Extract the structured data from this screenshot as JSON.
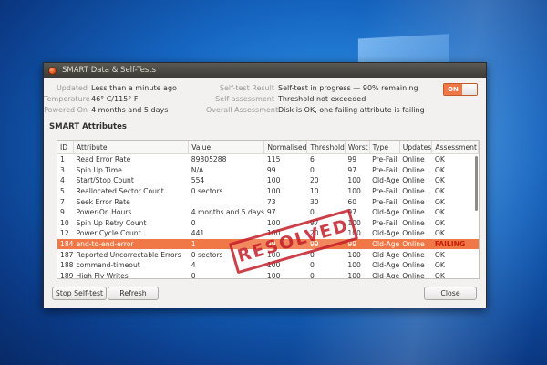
{
  "window": {
    "title": "SMART Data & Self-Tests"
  },
  "info": {
    "updated": {
      "label": "Updated",
      "value": "Less than a minute ago"
    },
    "temperature": {
      "label": "Temperature",
      "value": "46° C/115° F"
    },
    "powered_on": {
      "label": "Powered On",
      "value": "4 months and 5 days"
    },
    "self_test_result": {
      "label": "Self-test Result",
      "value": "Self-test in progress — 90% remaining"
    },
    "self_assessment": {
      "label": "Self-assessment",
      "value": "Threshold not exceeded"
    },
    "overall_assessment": {
      "label": "Overall Assessment",
      "value": "Disk is OK, one failing attribute is failing"
    }
  },
  "toggle": {
    "label": "ON"
  },
  "smart": {
    "section_title": "SMART Attributes",
    "columns": [
      "ID",
      "Attribute",
      "Value",
      "Normalised",
      "Threshold",
      "Worst",
      "Type",
      "Updates",
      "Assessment"
    ],
    "rows": [
      {
        "id": "1",
        "attribute": "Read Error Rate",
        "value": "89805288",
        "normalised": "115",
        "threshold": "6",
        "worst": "99",
        "type": "Pre-Fail",
        "updates": "Online",
        "assessment": "OK"
      },
      {
        "id": "3",
        "attribute": "Spin Up Time",
        "value": "N/A",
        "normalised": "99",
        "threshold": "0",
        "worst": "97",
        "type": "Pre-Fail",
        "updates": "Online",
        "assessment": "OK"
      },
      {
        "id": "4",
        "attribute": "Start/Stop Count",
        "value": "554",
        "normalised": "100",
        "threshold": "20",
        "worst": "100",
        "type": "Old-Age",
        "updates": "Online",
        "assessment": "OK"
      },
      {
        "id": "5",
        "attribute": "Reallocated Sector Count",
        "value": "0 sectors",
        "normalised": "100",
        "threshold": "10",
        "worst": "100",
        "type": "Pre-Fail",
        "updates": "Online",
        "assessment": "OK"
      },
      {
        "id": "7",
        "attribute": "Seek Error Rate",
        "value": "",
        "normalised": "73",
        "threshold": "30",
        "worst": "60",
        "type": "Pre-Fail",
        "updates": "Online",
        "assessment": "OK"
      },
      {
        "id": "9",
        "attribute": "Power-On Hours",
        "value": "4 months and 5 days",
        "normalised": "97",
        "threshold": "0",
        "worst": "97",
        "type": "Old-Age",
        "updates": "Online",
        "assessment": "OK"
      },
      {
        "id": "10",
        "attribute": "Spin Up Retry Count",
        "value": "0",
        "normalised": "100",
        "threshold": "97",
        "worst": "100",
        "type": "Pre-Fail",
        "updates": "Online",
        "assessment": "OK"
      },
      {
        "id": "12",
        "attribute": "Power Cycle Count",
        "value": "441",
        "normalised": "100",
        "threshold": "20",
        "worst": "100",
        "type": "Old-Age",
        "updates": "Online",
        "assessment": "OK"
      },
      {
        "id": "184",
        "attribute": "end-to-end-error",
        "value": "1",
        "normalised": "99",
        "threshold": "99",
        "worst": "99",
        "type": "Old-Age",
        "updates": "Online",
        "assessment": "FAILING",
        "failing": true
      },
      {
        "id": "187",
        "attribute": "Reported Uncorrectable Errors",
        "value": "0 sectors",
        "normalised": "100",
        "threshold": "0",
        "worst": "100",
        "type": "Old-Age",
        "updates": "Online",
        "assessment": "OK"
      },
      {
        "id": "188",
        "attribute": "command-timeout",
        "value": "4",
        "normalised": "100",
        "threshold": "0",
        "worst": "100",
        "type": "Old-Age",
        "updates": "Online",
        "assessment": "OK"
      },
      {
        "id": "189",
        "attribute": "High Fly Writes",
        "value": "0",
        "normalised": "100",
        "threshold": "0",
        "worst": "100",
        "type": "Old-Age",
        "updates": "Online",
        "assessment": "OK"
      }
    ]
  },
  "stamp": {
    "text": "RESOLVED",
    "color": "#c41f2b"
  },
  "buttons": {
    "stop_self_test": "Stop Self-test",
    "refresh": "Refresh",
    "close": "Close"
  },
  "colors": {
    "accent": "#f07746",
    "failing_text": "#c71d0a"
  }
}
